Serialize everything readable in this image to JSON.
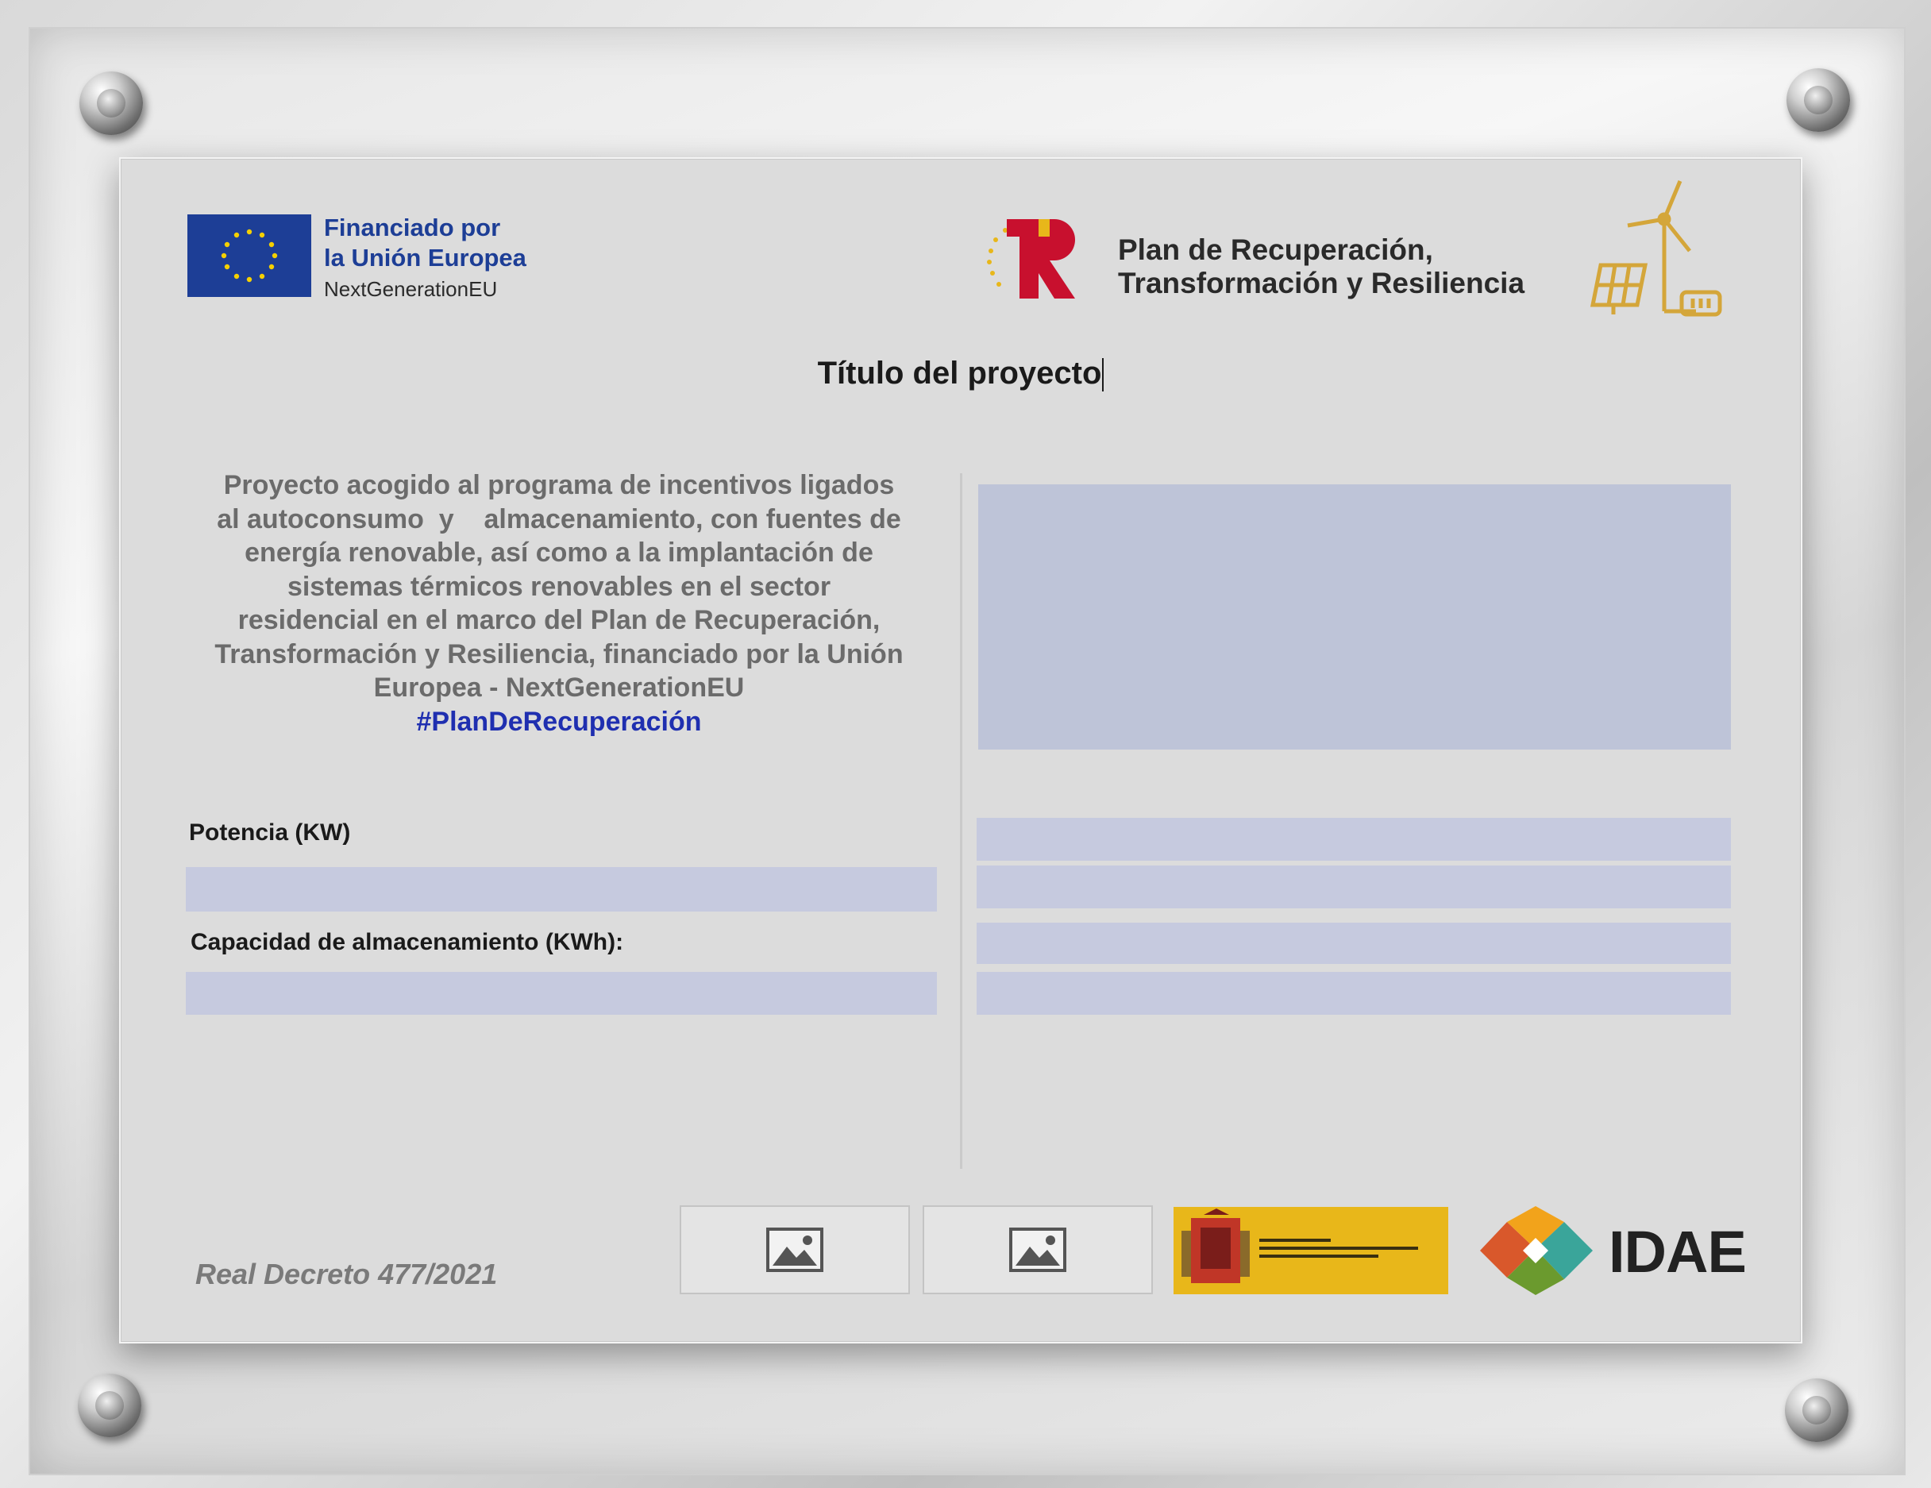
{
  "eu_funding": {
    "line1": "Financiado por",
    "line2": "la Unión Europea",
    "line3": "NextGenerationEU",
    "flag_color": "#1d3e96"
  },
  "plan": {
    "line1": "Plan de Recuperación,",
    "line2": "Transformación y Resiliencia",
    "logo_colors": [
      "#c8102e",
      "#e8b71a"
    ]
  },
  "title": "Título del proyecto",
  "description": {
    "lines": [
      "Proyecto acogido al programa de incentivos ligados",
      "al autoconsumo  y    almacenamiento, con fuentes de",
      "energía renovable, así como a la implantación de",
      "sistemas térmicos renovables en el sector",
      "residencial en el marco del  Plan de Recuperación,",
      "Transformación y Resiliencia, financiado por la Unión",
      "Europea - NextGenerationEU"
    ],
    "hashtag": "#PlanDeRecuperación"
  },
  "fields": {
    "power_label": "Potencia (KW)",
    "capacity_label": "Capacidad de almacenamiento (KWh):"
  },
  "footer": {
    "decree": "Real Decreto 477/2021",
    "idae": "IDAE"
  },
  "colors": {
    "field_fill": "#c6cadf",
    "hashtag": "#1f2fb0",
    "ministerio_bg": "#e8b71a"
  }
}
